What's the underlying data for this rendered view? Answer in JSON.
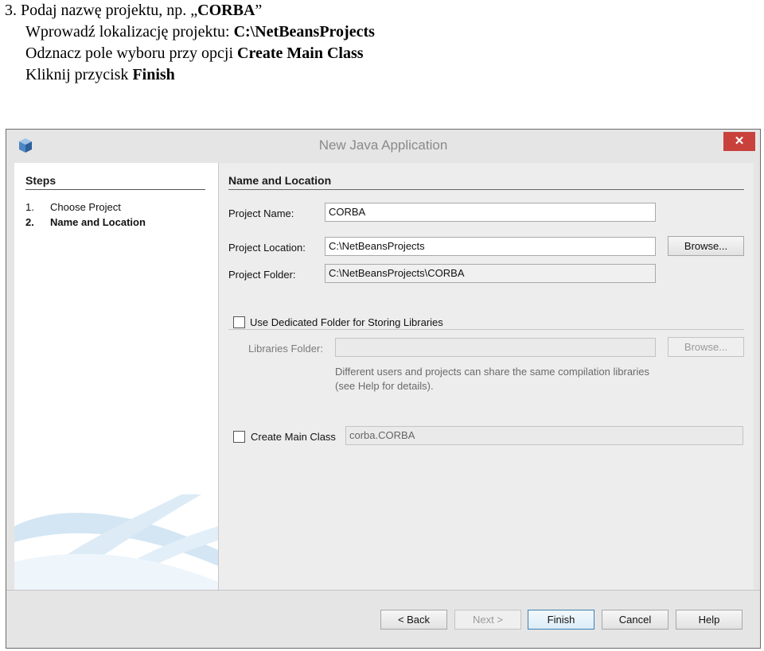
{
  "doc": {
    "line1": "3. Podaj nazwę projektu, np. „",
    "line1_bold": "CORBA",
    "line1_end": "”",
    "line2": "Wprowadź lokalizację projektu: ",
    "line2_bold": "C:\\NetBeansProjects",
    "line3": "Odznacz pole wyboru przy opcji ",
    "line3_bold": "Create Main Class",
    "line4": "Kliknij przycisk ",
    "line4_bold": "Finish"
  },
  "window": {
    "title": "New Java Application",
    "close": "✕"
  },
  "steps": {
    "heading": "Steps",
    "items": [
      {
        "num": "1.",
        "label": "Choose Project"
      },
      {
        "num": "2.",
        "label": "Name and Location"
      }
    ]
  },
  "form": {
    "heading": "Name and Location",
    "project_name_label": "Project Name:",
    "project_name_value": "CORBA",
    "project_location_label": "Project Location:",
    "project_location_value": "C:\\NetBeansProjects",
    "browse_label": "Browse...",
    "project_folder_label": "Project Folder:",
    "project_folder_value": "C:\\NetBeansProjects\\CORBA",
    "dedicated_folder_label": "Use Dedicated Folder for Storing Libraries",
    "libraries_folder_label": "Libraries Folder:",
    "libraries_folder_value": "",
    "libraries_browse_label": "Browse...",
    "note": "Different users and projects can share the same compilation libraries (see Help for details).",
    "create_main_class_label": "Create Main Class",
    "create_main_class_value": "corba.CORBA"
  },
  "buttons": {
    "back": "< Back",
    "next": "Next >",
    "finish": "Finish",
    "cancel": "Cancel",
    "help": "Help"
  },
  "colors": {
    "close_bg": "#c9413b",
    "default_button_border": "#3c7fb1"
  }
}
